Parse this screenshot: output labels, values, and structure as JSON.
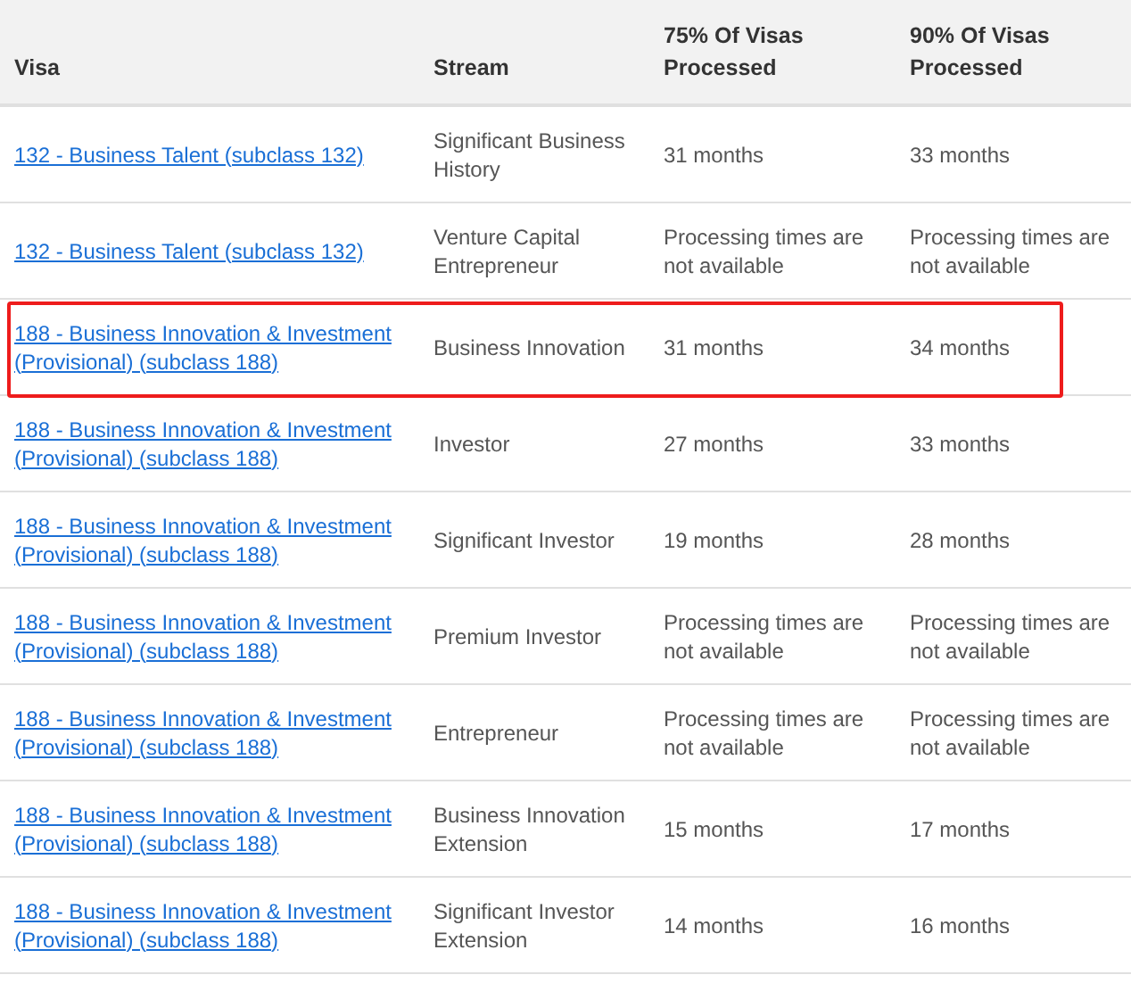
{
  "table": {
    "columns": [
      "Visa",
      "Stream",
      "75% Of Visas Processed",
      "90% Of Visas Processed"
    ],
    "rows": [
      {
        "visa": "132 - Business Talent (subclass 132)",
        "stream": "Significant Business History",
        "p75": "31 months",
        "p90": "33 months",
        "highlighted": false
      },
      {
        "visa": "132 - Business Talent (subclass 132)",
        "stream": "Venture Capital Entrepreneur",
        "p75": "Processing times are not available",
        "p90": "Processing times are not available",
        "highlighted": false
      },
      {
        "visa": "188 - Business Innovation & Investment (Provisional) (subclass 188)",
        "stream": "Business Innovation",
        "p75": "31 months",
        "p90": "34 months",
        "highlighted": true
      },
      {
        "visa": "188 - Business Innovation & Investment (Provisional) (subclass 188)",
        "stream": "Investor",
        "p75": "27 months",
        "p90": "33 months",
        "highlighted": false
      },
      {
        "visa": "188 - Business Innovation & Investment (Provisional) (subclass 188)",
        "stream": "Significant Investor",
        "p75": "19 months",
        "p90": "28 months",
        "highlighted": false
      },
      {
        "visa": "188 - Business Innovation & Investment (Provisional) (subclass 188)",
        "stream": "Premium Investor",
        "p75": "Processing times are not available",
        "p90": "Processing times are not available",
        "highlighted": false
      },
      {
        "visa": "188 - Business Innovation & Investment (Provisional) (subclass 188)",
        "stream": "Entrepreneur",
        "p75": "Processing times are not available",
        "p90": "Processing times are not available",
        "highlighted": false
      },
      {
        "visa": "188 - Business Innovation & Investment (Provisional) (subclass 188)",
        "stream": "Business Innovation Extension",
        "p75": "15 months",
        "p90": "17 months",
        "highlighted": false
      },
      {
        "visa": "188 - Business Innovation & Investment (Provisional) (subclass 188)",
        "stream": "Significant Investor Extension",
        "p75": "14 months",
        "p90": "16 months",
        "highlighted": false
      }
    ]
  }
}
